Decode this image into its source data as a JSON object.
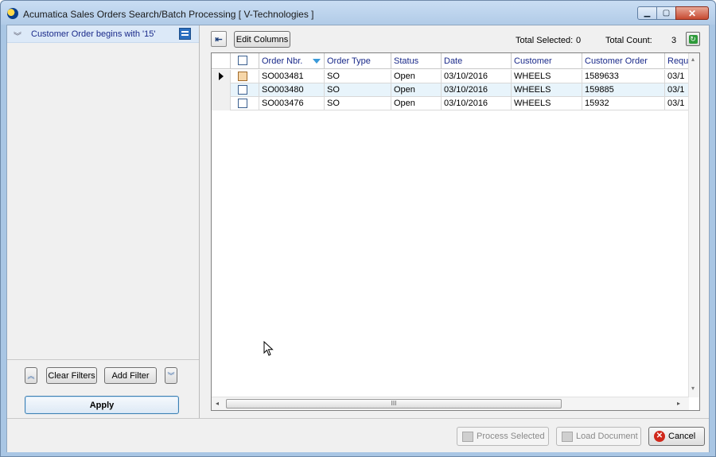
{
  "window": {
    "title": "Acumatica Sales Orders Search/Batch Processing [ V-Technologies ]",
    "minimize_glyph": "▁",
    "maximize_glyph": "▢",
    "close_glyph": "✕"
  },
  "filters": {
    "items": [
      {
        "label": "Customer Order begins with '15'"
      }
    ],
    "clear_label": "Clear Filters",
    "add_label": "Add Filter",
    "apply_label": "Apply",
    "move_up_glyph": "︽",
    "move_down_glyph": "︾",
    "expand_glyph": "︾"
  },
  "toolbar": {
    "collapse_glyph": "⇤",
    "edit_columns_label": "Edit Columns",
    "total_selected_label": "Total Selected:",
    "total_selected_value": "0",
    "total_count_label": "Total Count:",
    "total_count_value": "3",
    "refresh_glyph": "↻"
  },
  "grid": {
    "columns": [
      "Order Nbr.",
      "Order Type",
      "Status",
      "Date",
      "Customer",
      "Customer Order",
      "Requ"
    ],
    "rows": [
      [
        "SO003481",
        "SO",
        "Open",
        "03/10/2016",
        "WHEELS",
        "1589633",
        "03/1"
      ],
      [
        "SO003480",
        "SO",
        "Open",
        "03/10/2016",
        "WHEELS",
        "159885",
        "03/1"
      ],
      [
        "SO003476",
        "SO",
        "Open",
        "03/10/2016",
        "WHEELS",
        "15932",
        "03/1"
      ]
    ],
    "scroll_grip_glyph": "III",
    "scroll_left_glyph": "◂",
    "scroll_right_glyph": "▸",
    "scroll_up_glyph": "▴",
    "scroll_down_glyph": "▾"
  },
  "actions": {
    "process_label": "Process Selected",
    "load_label": "Load Document",
    "cancel_label": "Cancel",
    "cancel_glyph": "✕"
  },
  "colors": {
    "accent": "#1a2a8a",
    "title_bar": "#b1cbe7",
    "row_alt": "#e8f4fb"
  }
}
